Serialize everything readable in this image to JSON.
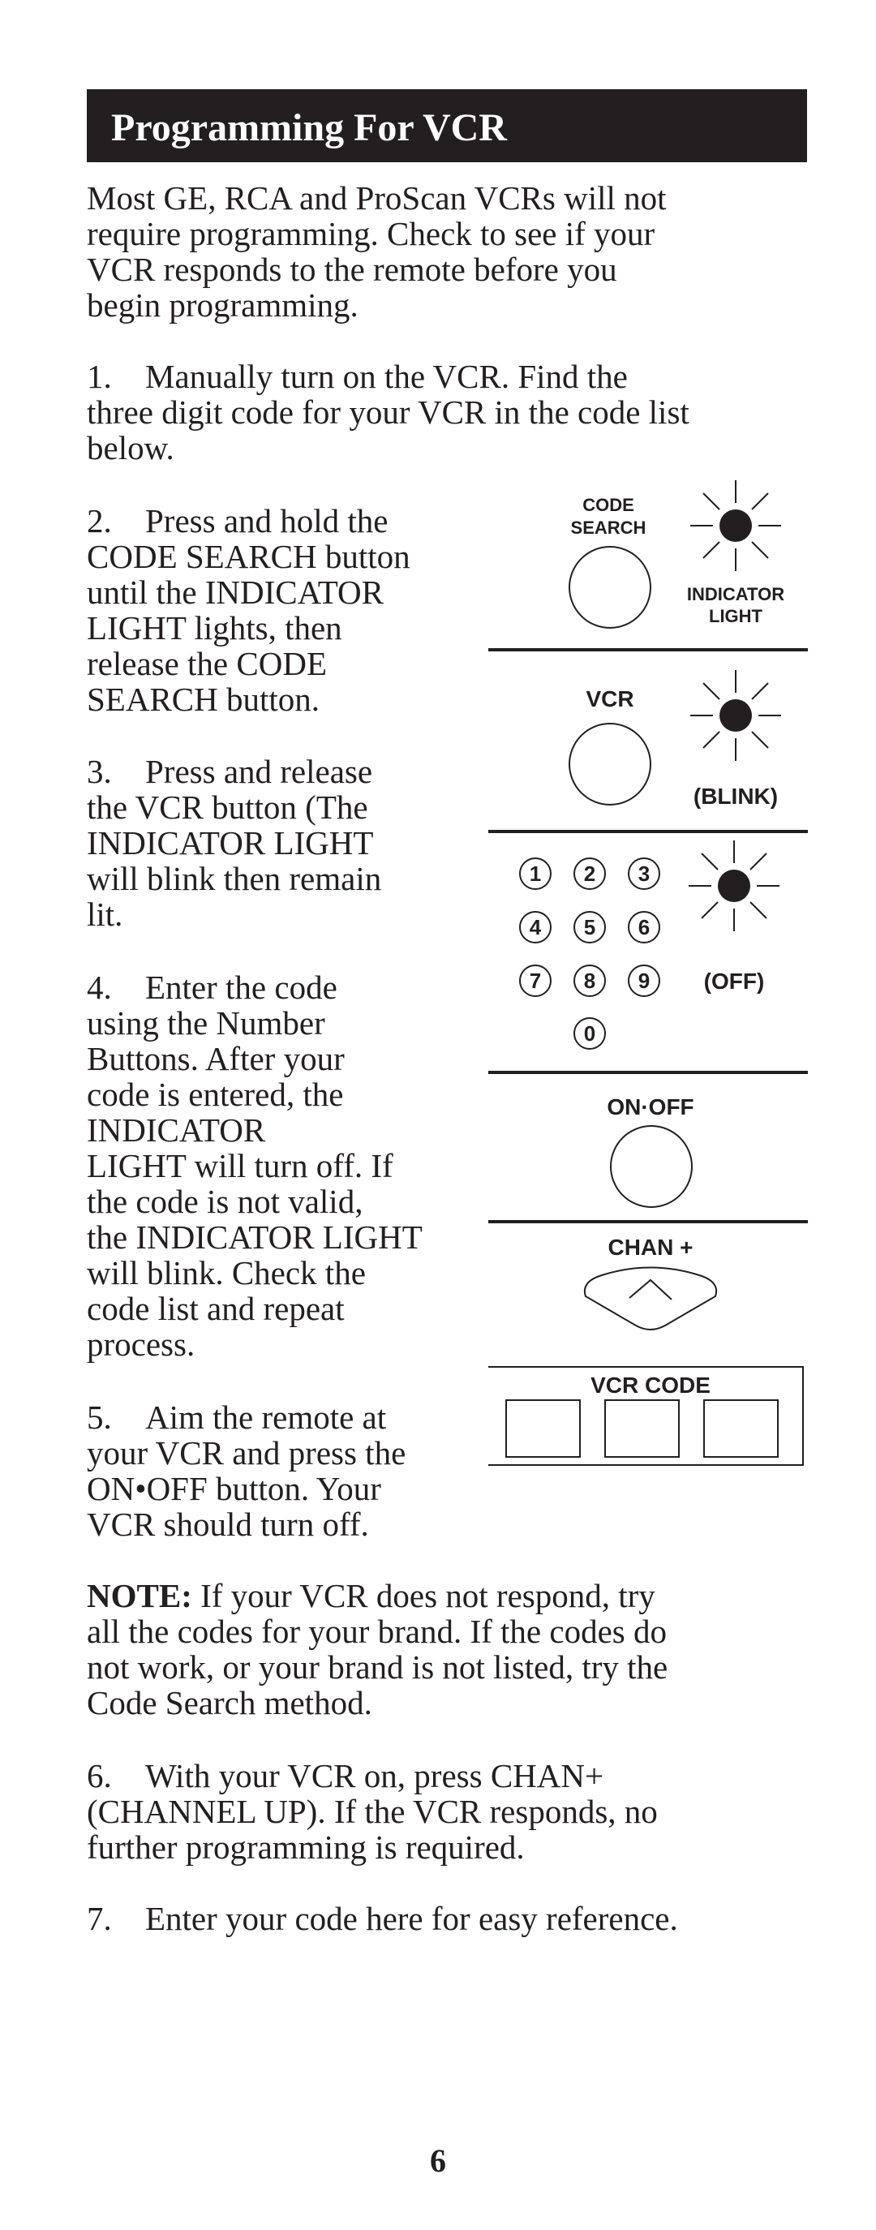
{
  "header": {
    "title": "Programming For VCR"
  },
  "intro": "Most GE, RCA and ProScan VCRs will not\nrequire programming. Check to see if your\nVCR responds to the remote before you\nbegin programming.",
  "steps": [
    {
      "num": "1.",
      "text": "Manually turn on the VCR. Find the\nthree digit code for your VCR in the code list\nbelow."
    },
    {
      "num": "2.",
      "text": "Press and hold the\nCODE SEARCH button\nuntil the INDICATOR\nLIGHT lights, then\nrelease the CODE\nSEARCH button."
    },
    {
      "num": "3.",
      "text": "Press and release\nthe VCR button (The\nINDICATOR LIGHT\nwill blink then remain\nlit."
    },
    {
      "num": "4.",
      "text": "Enter the code\nusing the Number\nButtons. After your\ncode is entered, the\nINDICATOR\nLIGHT will turn off. If\nthe code is not valid,\nthe INDICATOR LIGHT\nwill blink. Check the\ncode list and repeat\nprocess."
    },
    {
      "num": "5.",
      "text": "Aim the remote at\nyour VCR and press the\nON•OFF button. Your\nVCR should turn off."
    },
    {
      "num": "6.",
      "text": "With your VCR on, press CHAN+\n(CHANNEL UP). If the VCR responds, no\nfurther programming is required."
    },
    {
      "num": "7.",
      "text": "Enter your code here for easy reference."
    }
  ],
  "note": {
    "label": "NOTE:",
    "text": " If your VCR does not respond, try\nall the codes for your brand. If the codes do\nnot work, or your brand is not listed, try the\nCode Search method."
  },
  "diagram": {
    "code_search_label_1": "CODE",
    "code_search_label_2": "SEARCH",
    "indicator_label_1": "INDICATOR",
    "indicator_label_2": "LIGHT",
    "vcr_label": "VCR",
    "blink_label": "(BLINK)",
    "off_label": "(OFF)",
    "number_buttons": [
      "1",
      "2",
      "3",
      "4",
      "5",
      "6",
      "7",
      "8",
      "9",
      "0"
    ],
    "on_off_label": "ON·OFF",
    "chan_label": "CHAN +",
    "vcr_code_label": "VCR CODE",
    "vcr_code_values": [
      "",
      "",
      ""
    ]
  },
  "page_number": "6"
}
